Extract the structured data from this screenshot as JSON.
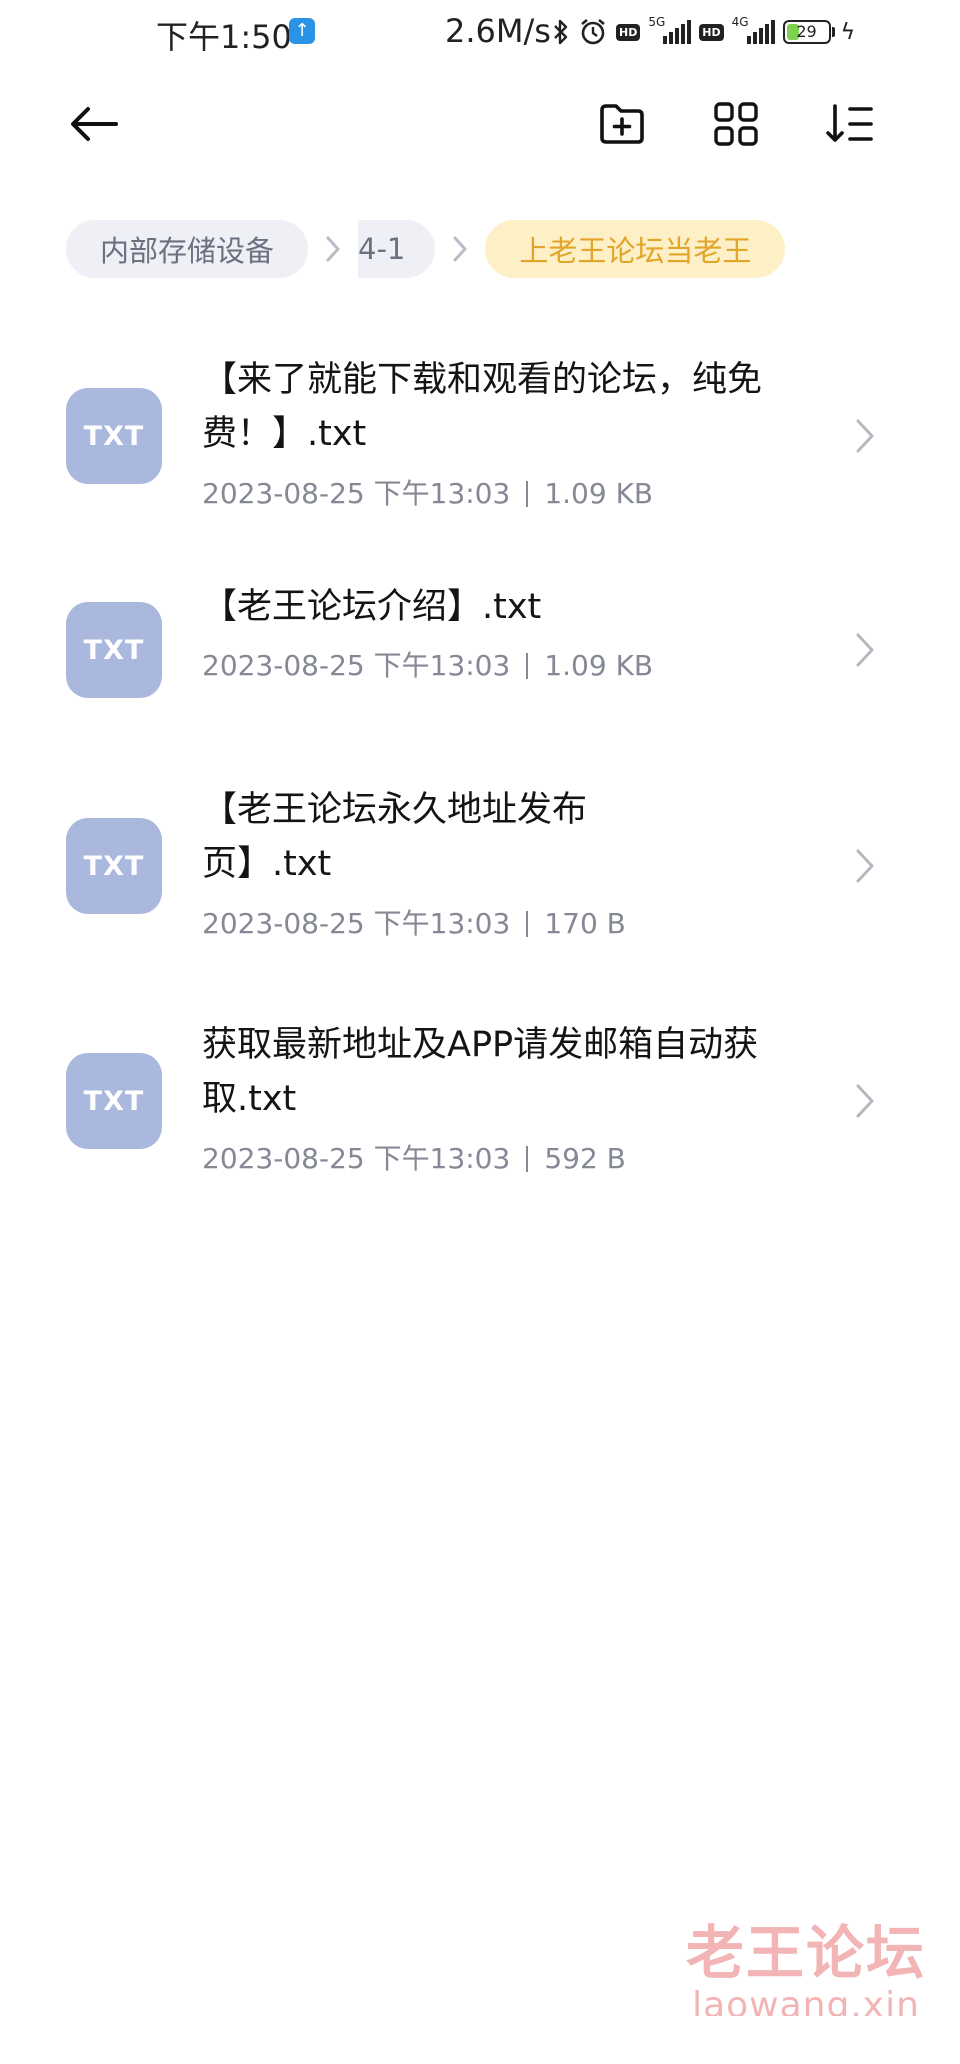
{
  "status_bar": {
    "time": "下午1:50",
    "upload_icon": "arrow-up-icon",
    "net_speed": "2.6M/s",
    "icons": [
      "bluetooth-icon",
      "alarm-icon",
      "hd-icon",
      "5g-signal-icon",
      "hd-icon",
      "4g-signal-icon"
    ],
    "hd_label": "HD",
    "sim1_network": "5G",
    "sim2_network": "4G",
    "battery_level": "29",
    "battery_fraction": 0.29,
    "charging_icon": "lightning-icon",
    "battery_fill_color": "#7dd34f"
  },
  "toolbar": {
    "back_icon": "arrow-left-icon",
    "new_folder_icon": "folder-plus-icon",
    "grid_view_icon": "grid-icon",
    "sort_icon": "sort-icon"
  },
  "breadcrumb": {
    "items": [
      "内部存储设备",
      "4-1",
      "上老王论坛当老王"
    ],
    "separator_icon": "chevron-right-icon",
    "current_color": "#e2a52a"
  },
  "files": [
    {
      "type_label": "TXT",
      "name": "【来了就能下载和观看的论坛，纯免费！】.txt",
      "date": "2023-08-25 下午13:03",
      "size": "1.09 KB"
    },
    {
      "type_label": "TXT",
      "name": "【老王论坛介绍】.txt",
      "date": "2023-08-25 下午13:03",
      "size": "1.09 KB"
    },
    {
      "type_label": "TXT",
      "name": "【老王论坛永久地址发布页】.txt",
      "date": "2023-08-25 下午13:03",
      "size": "170 B"
    },
    {
      "type_label": "TXT",
      "name": "获取最新地址及APP请发邮箱自动获取.txt",
      "date": "2023-08-25 下午13:03",
      "size": "592 B"
    }
  ],
  "file_icon_color": "#a9b8dc",
  "watermark": {
    "cn": "老王论坛",
    "en": "laowang.xin",
    "color": "#f0a7a7"
  }
}
